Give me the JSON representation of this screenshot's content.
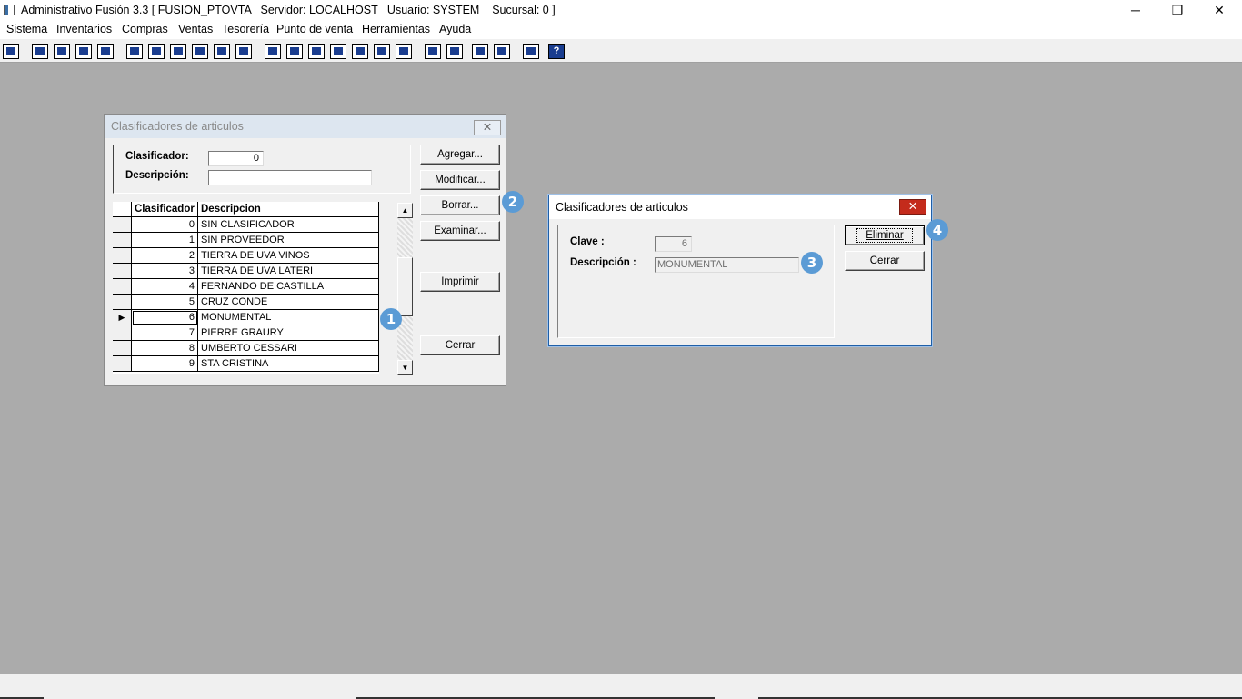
{
  "window": {
    "title": "Administrativo Fusión 3.3 [ FUSION_PTOVTA   Servidor: LOCALHOST   Usuario: SYSTEM    Sucursal: 0 ]",
    "minimize_glyph": "─",
    "restore_glyph": "❐",
    "close_glyph": "✕"
  },
  "menu": {
    "items": [
      "Sistema",
      "Inventarios",
      "Compras",
      "Ventas",
      "Tesorería",
      "Punto de venta",
      "Herramientas",
      "Ayuda"
    ]
  },
  "toolbar": {
    "icons": [
      "calculator-icon",
      "copy-icon",
      "clipboard-icon",
      "transfer-icon",
      "find-icon",
      "user-icon",
      "folder-icon",
      "import-icon",
      "print-icon",
      "document-icon",
      "list-icon",
      "binoculars-icon",
      "box-icon",
      "export-icon",
      "add-icon",
      "money-icon",
      "report-icon",
      "table-icon",
      "home-icon",
      "zoom-icon",
      "refresh-icon",
      "undo-icon",
      "back-icon",
      "help-icon"
    ],
    "last_glyph": "?"
  },
  "list_dialog": {
    "title": "Clasificadores de articulos",
    "close_glyph": "✕",
    "clasificador_label": "Clasificador:",
    "clasificador_value": "0",
    "descripcion_label": "Descripción:",
    "descripcion_value": "",
    "buttons": {
      "agregar": "Agregar...",
      "modificar": "Modificar...",
      "borrar": "Borrar...",
      "examinar": "Examinar...",
      "imprimir": "Imprimir",
      "cerrar": "Cerrar"
    },
    "grid": {
      "columns": [
        "Clasificador",
        "Descripcion"
      ],
      "selected_marker": "▶",
      "rows": [
        {
          "clave": "0",
          "descripcion": "SIN CLASIFICADOR"
        },
        {
          "clave": "1",
          "descripcion": "SIN PROVEEDOR"
        },
        {
          "clave": "2",
          "descripcion": "TIERRA DE UVA VINOS"
        },
        {
          "clave": "3",
          "descripcion": "TIERRA DE UVA LATERI"
        },
        {
          "clave": "4",
          "descripcion": "FERNANDO DE CASTILLA"
        },
        {
          "clave": "5",
          "descripcion": "CRUZ CONDE"
        },
        {
          "clave": "6",
          "descripcion": "MONUMENTAL"
        },
        {
          "clave": "7",
          "descripcion": "PIERRE GRAURY"
        },
        {
          "clave": "8",
          "descripcion": "UMBERTO CESSARI"
        },
        {
          "clave": "9",
          "descripcion": "STA CRISTINA"
        }
      ],
      "selected_index": 6
    },
    "scroll_up": "▲",
    "scroll_down": "▼"
  },
  "delete_dialog": {
    "title": "Clasificadores de articulos",
    "close_glyph": "✕",
    "clave_label": "Clave :",
    "clave_value": "6",
    "descripcion_label": "Descripción :",
    "descripcion_value": "MONUMENTAL",
    "buttons": {
      "eliminar": "Eliminar",
      "cerrar": "Cerrar"
    }
  },
  "badges": [
    "1",
    "2",
    "3",
    "4"
  ],
  "colors": {
    "badge": "#5b9bd5",
    "desktop": "#ababab",
    "close_red": "#c42b1c"
  }
}
